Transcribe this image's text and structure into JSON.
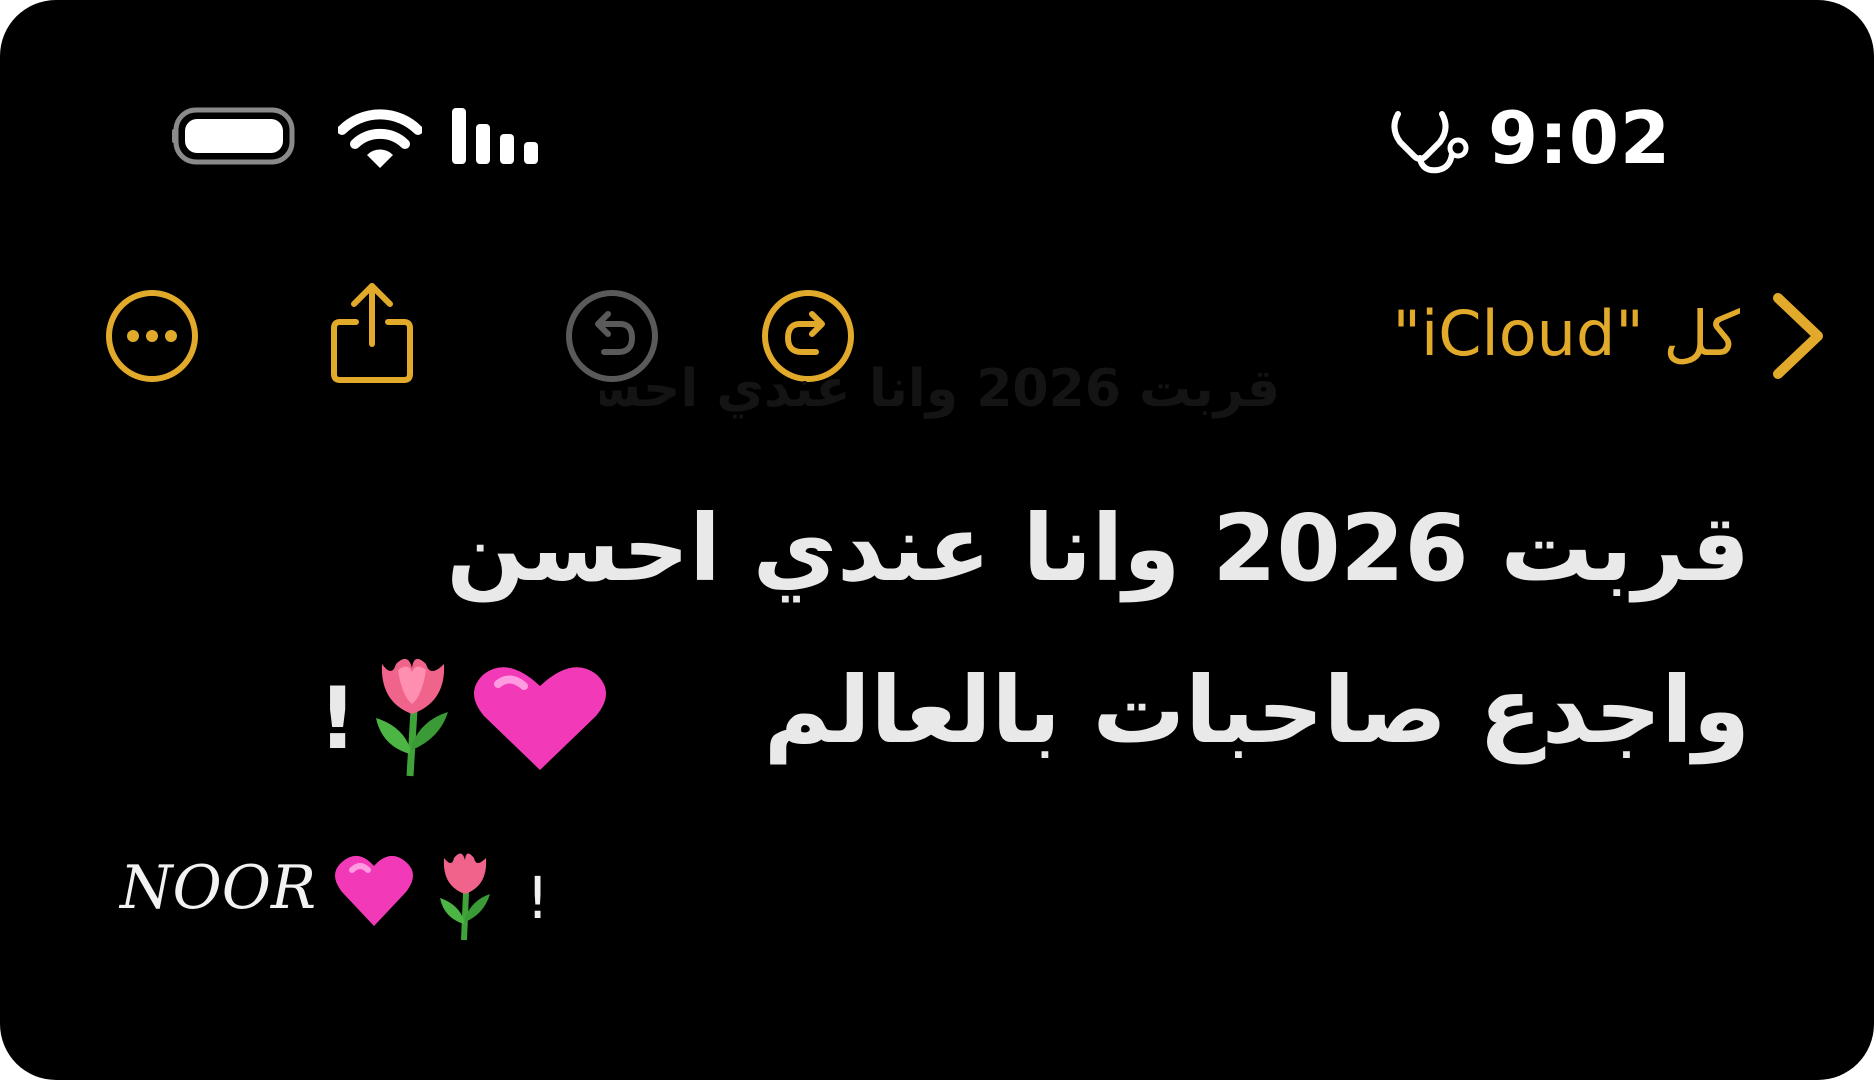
{
  "status_bar": {
    "time": "9:02",
    "icons": [
      "battery-icon",
      "wifi-icon",
      "signal-icon",
      "stethoscope-icon"
    ]
  },
  "toolbar": {
    "back_label": "كل \"iCloud\"",
    "icons": [
      "chevron-back-icon",
      "redo-icon",
      "undo-icon",
      "share-icon",
      "more-icon"
    ],
    "accent_color": "#E2AA2B",
    "disabled_color": "#5A5A5A"
  },
  "note": {
    "title_line_1": "قربت 2026 وانا عندي احسن",
    "title_line_2": "واجدع صاحبات بالعالم",
    "title_suffix": "!",
    "title_emojis": [
      "pink-heart",
      "tulip"
    ],
    "signature_name": "NOOR",
    "signature_suffix": "!",
    "signature_emojis": [
      "pink-heart",
      "tulip"
    ]
  }
}
